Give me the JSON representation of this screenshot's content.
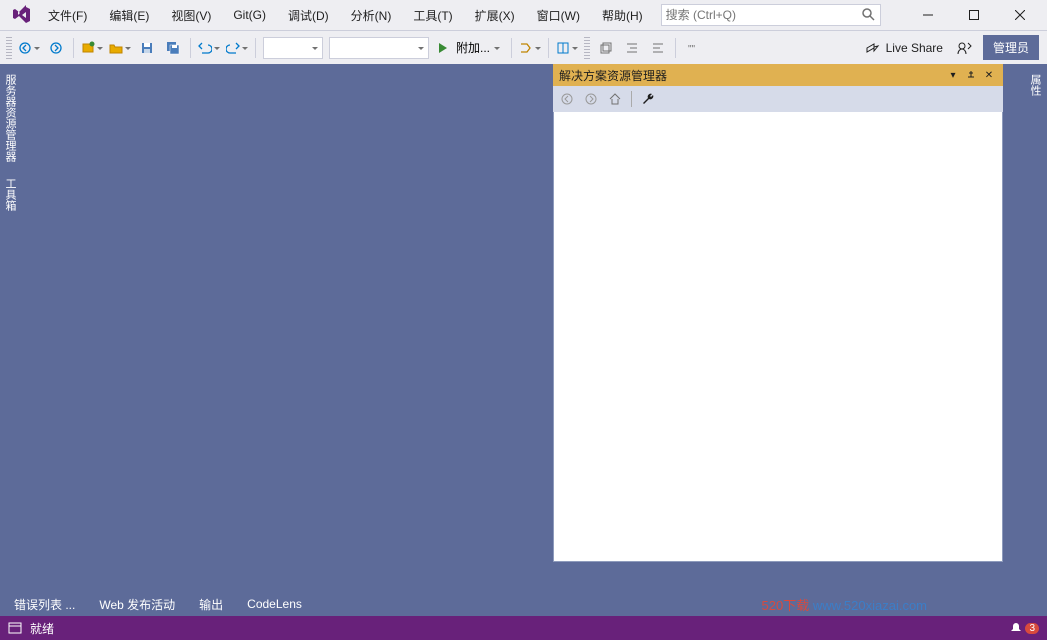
{
  "menu": {
    "file": "文件(F)",
    "edit": "编辑(E)",
    "view": "视图(V)",
    "git": "Git(G)",
    "debug": "调试(D)",
    "analyze": "分析(N)",
    "tools": "工具(T)",
    "extensions": "扩展(X)",
    "window": "窗口(W)",
    "help": "帮助(H)"
  },
  "search": {
    "placeholder": "搜索 (Ctrl+Q)"
  },
  "toolbar": {
    "attach": "附加...",
    "liveshare": "Live Share",
    "admin": "管理员"
  },
  "leftTabs": {
    "server": "服务器资源管理器",
    "toolbox": "工具箱"
  },
  "solutionPanel": {
    "title": "解决方案资源管理器"
  },
  "rightTabs": {
    "props": "属性"
  },
  "bottomTabs": {
    "errors": "错误列表 ...",
    "webpub": "Web 发布活动",
    "output": "输出",
    "codelens": "CodeLens"
  },
  "status": {
    "ready": "就绪",
    "notif_count": "3"
  },
  "watermark": {
    "text1": "520下载 ",
    "text2": "www.520xiazai.com"
  }
}
